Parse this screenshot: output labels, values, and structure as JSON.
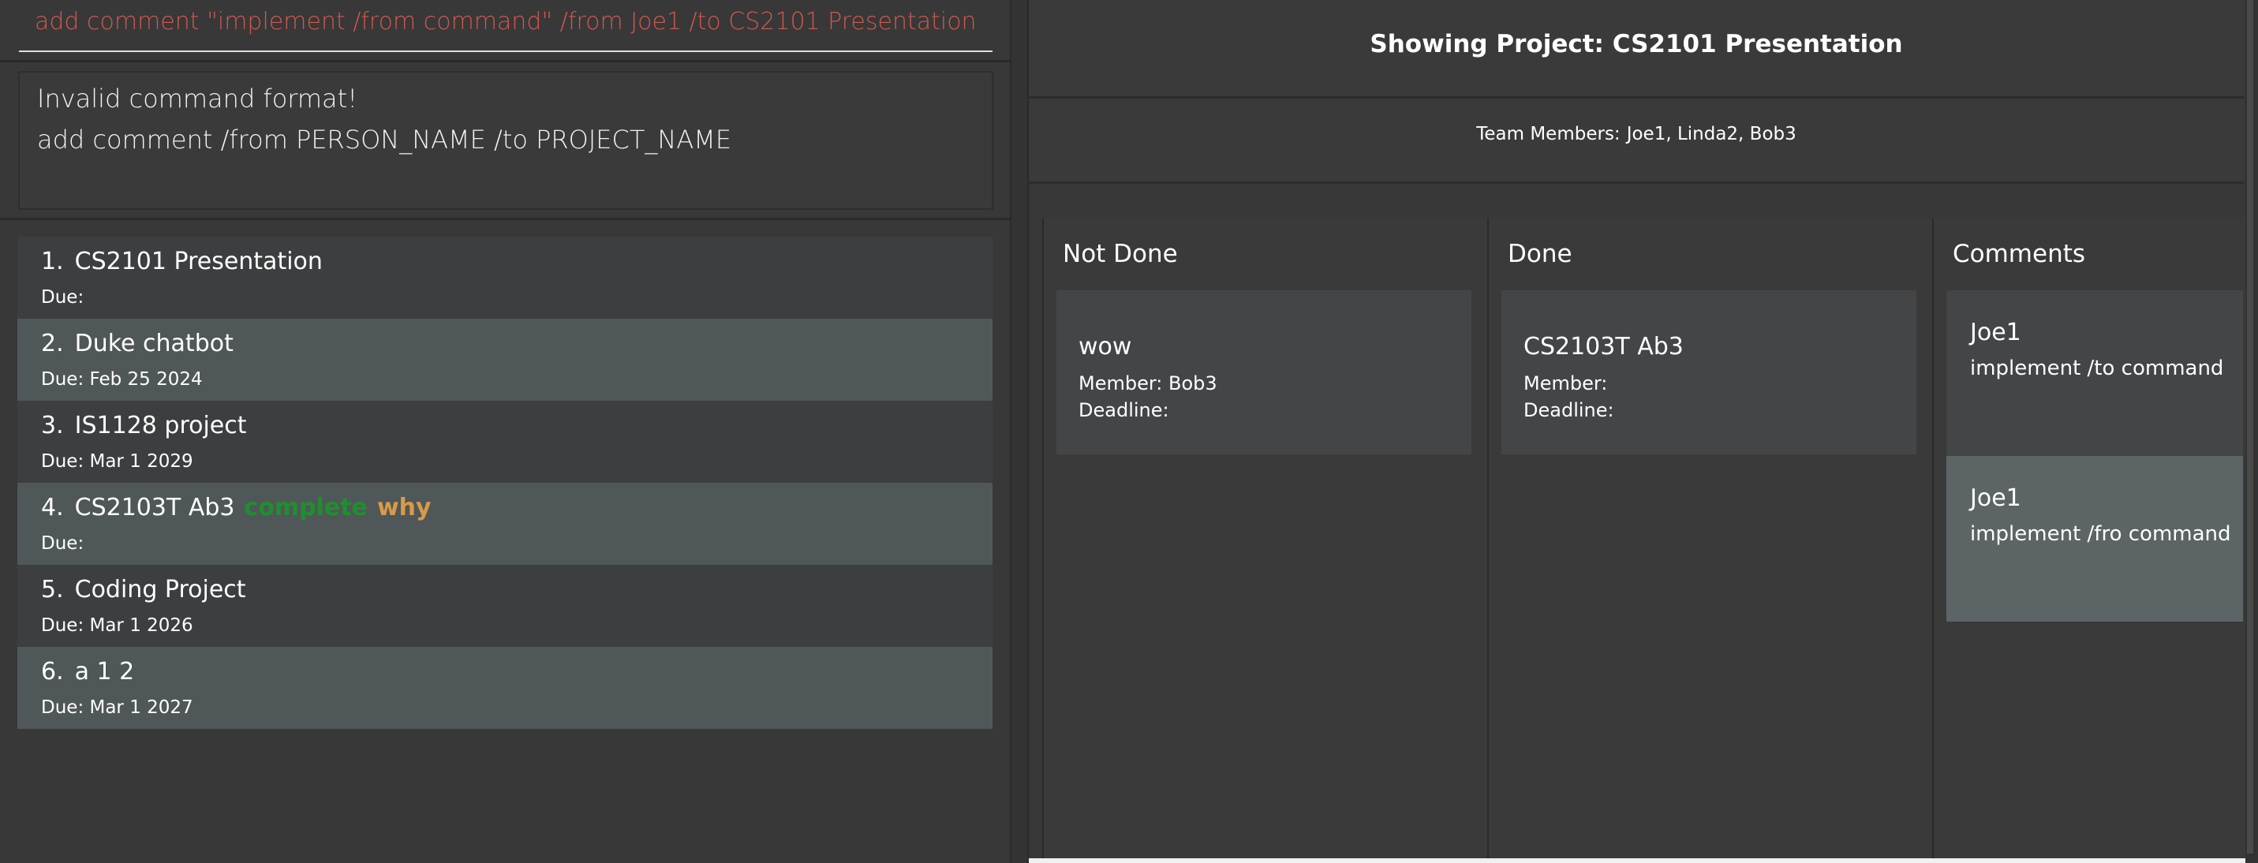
{
  "command": {
    "value": "add comment \"implement /from command\" /from Joe1 /to CS2101 Presentation"
  },
  "result": {
    "line1": "Invalid command format!",
    "line2": "add comment /from PERSON_NAME /to PROJECT_NAME"
  },
  "projects": [
    {
      "index": "1.",
      "name": "CS2101 Presentation",
      "due": "Due:"
    },
    {
      "index": "2.",
      "name": "Duke chatbot",
      "due": "Due: Feb 25 2024"
    },
    {
      "index": "3.",
      "name": "IS1128 project",
      "due": "Due: Mar 1 2029"
    },
    {
      "index": "4.",
      "name": "CS2103T Ab3",
      "tag_complete": "complete",
      "tag_why": "why",
      "due": "Due:"
    },
    {
      "index": "5.",
      "name": "Coding Project",
      "due": "Due: Mar 1 2026"
    },
    {
      "index": "6.",
      "name": "a  1 2",
      "due": "Due: Mar 1 2027"
    }
  ],
  "detail": {
    "title": "Showing Project: CS2101 Presentation",
    "members_label": "Team Members:",
    "members": "Joe1, Linda2, Bob3"
  },
  "columns": {
    "not_done": {
      "title": "Not Done",
      "tasks": [
        {
          "name": "wow",
          "member": "Member: Bob3",
          "deadline": "Deadline:"
        }
      ]
    },
    "done": {
      "title": "Done",
      "tasks": [
        {
          "name": "CS2103T Ab3",
          "member": "Member:",
          "deadline": "Deadline:"
        }
      ]
    },
    "comments": {
      "title": "Comments",
      "items": [
        {
          "author": "Joe1",
          "text": "implement /to command"
        },
        {
          "author": "Joe1",
          "text": "implement /fro command"
        }
      ]
    }
  },
  "colors": {
    "command_text": "#d0584e",
    "tag_complete": "#1f8f2d",
    "tag_why": "#d99b47"
  }
}
